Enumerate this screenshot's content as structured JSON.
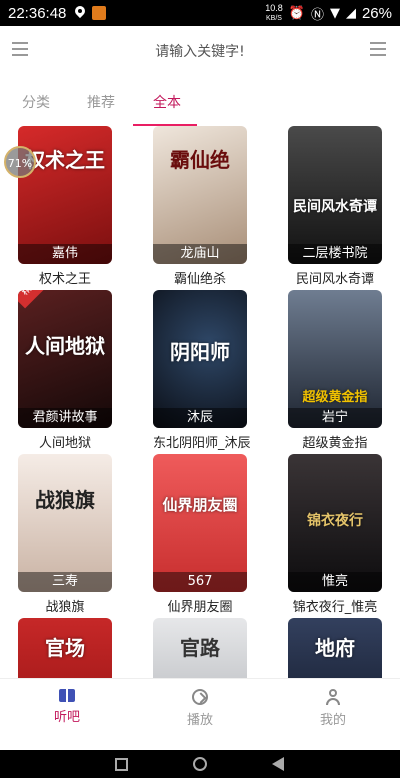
{
  "status_bar": {
    "time": "22:36:48",
    "speed_value": "10.8",
    "speed_unit": "KB/S",
    "battery": "26%",
    "icons": [
      "location-icon",
      "app-icon",
      "alarm-icon",
      "nfc-icon",
      "wifi-icon",
      "signal-icon",
      "battery-icon"
    ]
  },
  "search": {
    "placeholder": "请输入关键字!"
  },
  "tabs": [
    {
      "label": "分类"
    },
    {
      "label": "推荐"
    },
    {
      "label": "全本",
      "active": true
    }
  ],
  "progress_badge": "71%",
  "books": [
    {
      "cover_text": "权术之王",
      "author": "嘉伟",
      "title": "权术之王",
      "bg": "#a81c1c"
    },
    {
      "cover_text": "霸仙绝",
      "author": "龙庙山",
      "title": "霸仙绝杀",
      "bg": "#c9b6a4"
    },
    {
      "cover_text": "民间风水奇谭",
      "author": "二层楼书院",
      "title": "民间风水奇谭",
      "bg": "#2e2e2e"
    },
    {
      "cover_text": "人间地狱",
      "author": "君颜讲故事",
      "title": "人间地狱",
      "bg": "#3a1a1a",
      "tag": "精品"
    },
    {
      "cover_text": "阴阳师",
      "author": "沐辰",
      "title": "东北阴阳师_沐辰",
      "bg": "#151a24"
    },
    {
      "cover_text": "超级黄金指",
      "author": "岩宁",
      "title": "超级黄金指",
      "bg": "#3b4656"
    },
    {
      "cover_text": "战狼旗",
      "author": "三寿",
      "title": "战狼旗",
      "bg": "#e9ddd5"
    },
    {
      "cover_text": "仙界朋友圈",
      "author": "567",
      "title": "仙界朋友圈",
      "bg": "#e24a4a"
    },
    {
      "cover_text": "锦衣夜行",
      "author": "惟亮",
      "title": "锦衣夜行_惟亮",
      "bg": "#1f1d22"
    },
    {
      "cover_text": "官场",
      "author": "",
      "title": "",
      "bg": "#b8201e"
    },
    {
      "cover_text": "官路",
      "author": "",
      "title": "",
      "bg": "#cfd1d4"
    },
    {
      "cover_text": "地府",
      "author": "",
      "title": "",
      "bg": "#1c2438"
    }
  ],
  "bottom_nav": [
    {
      "label": "听吧",
      "icon": "book-icon",
      "active": true
    },
    {
      "label": "播放",
      "icon": "compass-icon"
    },
    {
      "label": "我的",
      "icon": "user-icon"
    }
  ],
  "colors": {
    "accent": "#e91e63",
    "active_text": "#c2185b"
  }
}
